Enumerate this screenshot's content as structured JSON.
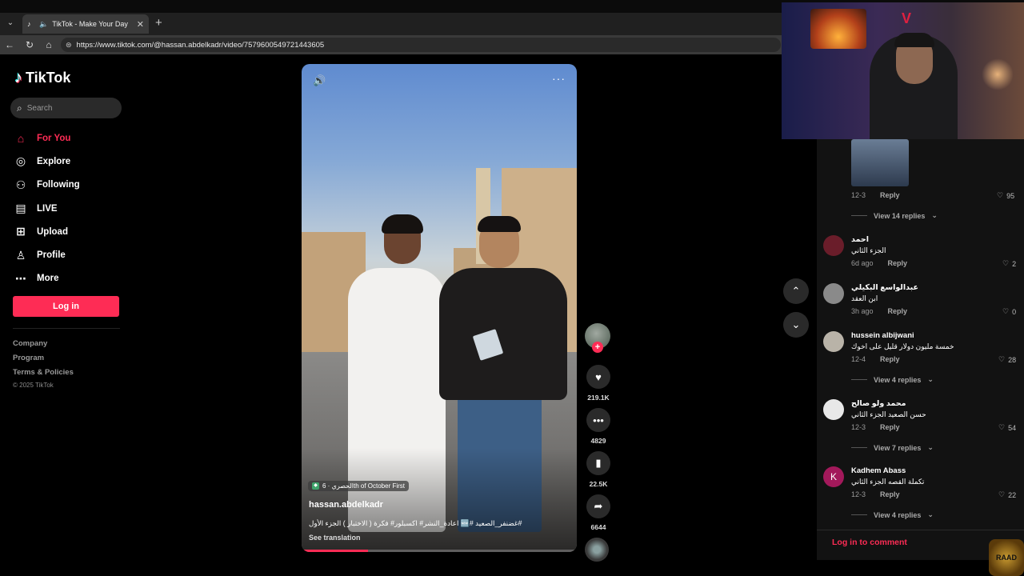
{
  "browser": {
    "tab_title": "TikTok - Make Your Day",
    "url": "https://www.tiktok.com/@hassan.abdelkadr/video/7579600549721443605"
  },
  "sidebar": {
    "brand": "TikTok",
    "search_placeholder": "Search",
    "nav": [
      {
        "label": "For You",
        "icon": "home-icon",
        "active": true
      },
      {
        "label": "Explore",
        "icon": "compass-icon"
      },
      {
        "label": "Following",
        "icon": "following-icon"
      },
      {
        "label": "LIVE",
        "icon": "live-icon"
      },
      {
        "label": "Upload",
        "icon": "upload-icon"
      },
      {
        "label": "Profile",
        "icon": "profile-icon"
      },
      {
        "label": "More",
        "icon": "more-icon"
      }
    ],
    "login_label": "Log in",
    "footer": [
      "Company",
      "Program",
      "Terms & Policies"
    ],
    "copyright": "© 2025 TikTok"
  },
  "video": {
    "location_tag": "الحصري · 6th of October First",
    "author": "hassan.abdelkadr",
    "caption": "#غضنفر_الصعيد #🆕 اعادة_النشر# اكسبلور# فكرة ( الاختبار ) الجزء الأول",
    "see_translation": "See translation",
    "progress": 0.24
  },
  "actions": {
    "likes": "219.1K",
    "comments": "4829",
    "saves": "22.5K",
    "shares": "6644"
  },
  "comments": {
    "top_reply": {
      "date": "12-3",
      "reply": "Reply",
      "likes": "95",
      "view_replies": "View 14 replies"
    },
    "items": [
      {
        "user": "احمد",
        "text": "الجزء الثاني",
        "date": "6d ago",
        "reply": "Reply",
        "likes": "2",
        "avatar_color": "#6a1d2a"
      },
      {
        "user": "عبدالواسع البكيلي",
        "text": "ابن العقد",
        "date": "3h ago",
        "reply": "Reply",
        "likes": "0",
        "avatar_color": "#8a8a8a"
      },
      {
        "user": "hussein albijwani",
        "text": "خمسة مليون دولار قليل على اخوك",
        "date": "12-4",
        "reply": "Reply",
        "likes": "28",
        "view_replies": "View 4 replies",
        "avatar_color": "#b9b3a8"
      },
      {
        "user": "محمد ولو صالح",
        "text": "حسن الصعيد الجزء الثاني",
        "date": "12-3",
        "reply": "Reply",
        "likes": "54",
        "view_replies": "View 7 replies",
        "avatar_color": "#e8e8e8"
      },
      {
        "user": "Kadhem Abass",
        "text": "تكملة القصه الجزء الثاني",
        "date": "12-3",
        "reply": "Reply",
        "likes": "22",
        "view_replies": "View 4 replies",
        "avatar_color": "#a3195b",
        "avatar_letter": "K"
      }
    ],
    "login_to_comment": "Log in to comment"
  },
  "overlay": {
    "badge_text": "RAAD"
  }
}
